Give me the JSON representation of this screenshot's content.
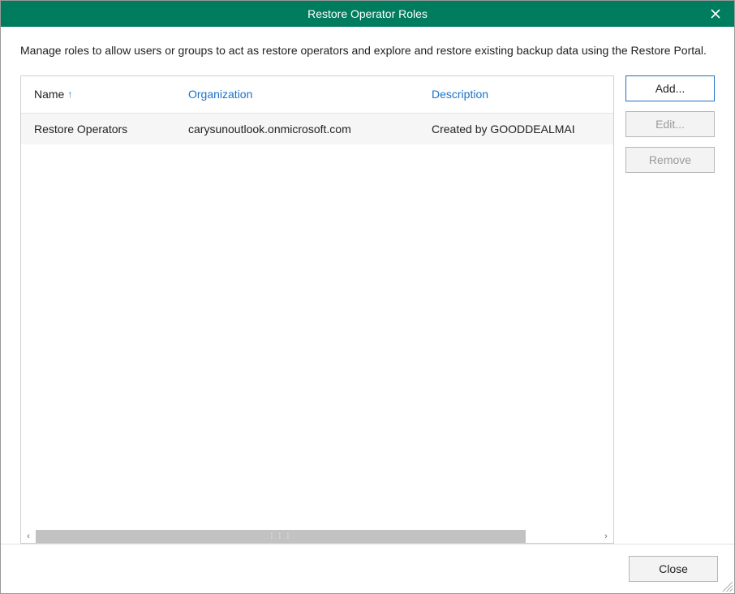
{
  "title": "Restore Operator Roles",
  "description": "Manage roles to allow users or groups to act as restore operators and explore and restore existing backup data using the Restore Portal.",
  "table": {
    "headers": {
      "name": "Name",
      "organization": "Organization",
      "description": "Description"
    },
    "sort_indicator": "↑",
    "rows": [
      {
        "name": "Restore Operators",
        "organization": "carysunoutlook.onmicrosoft.com",
        "description": "Created by GOODDEALMAI"
      }
    ]
  },
  "buttons": {
    "add": "Add...",
    "edit": "Edit...",
    "remove": "Remove",
    "close": "Close"
  }
}
